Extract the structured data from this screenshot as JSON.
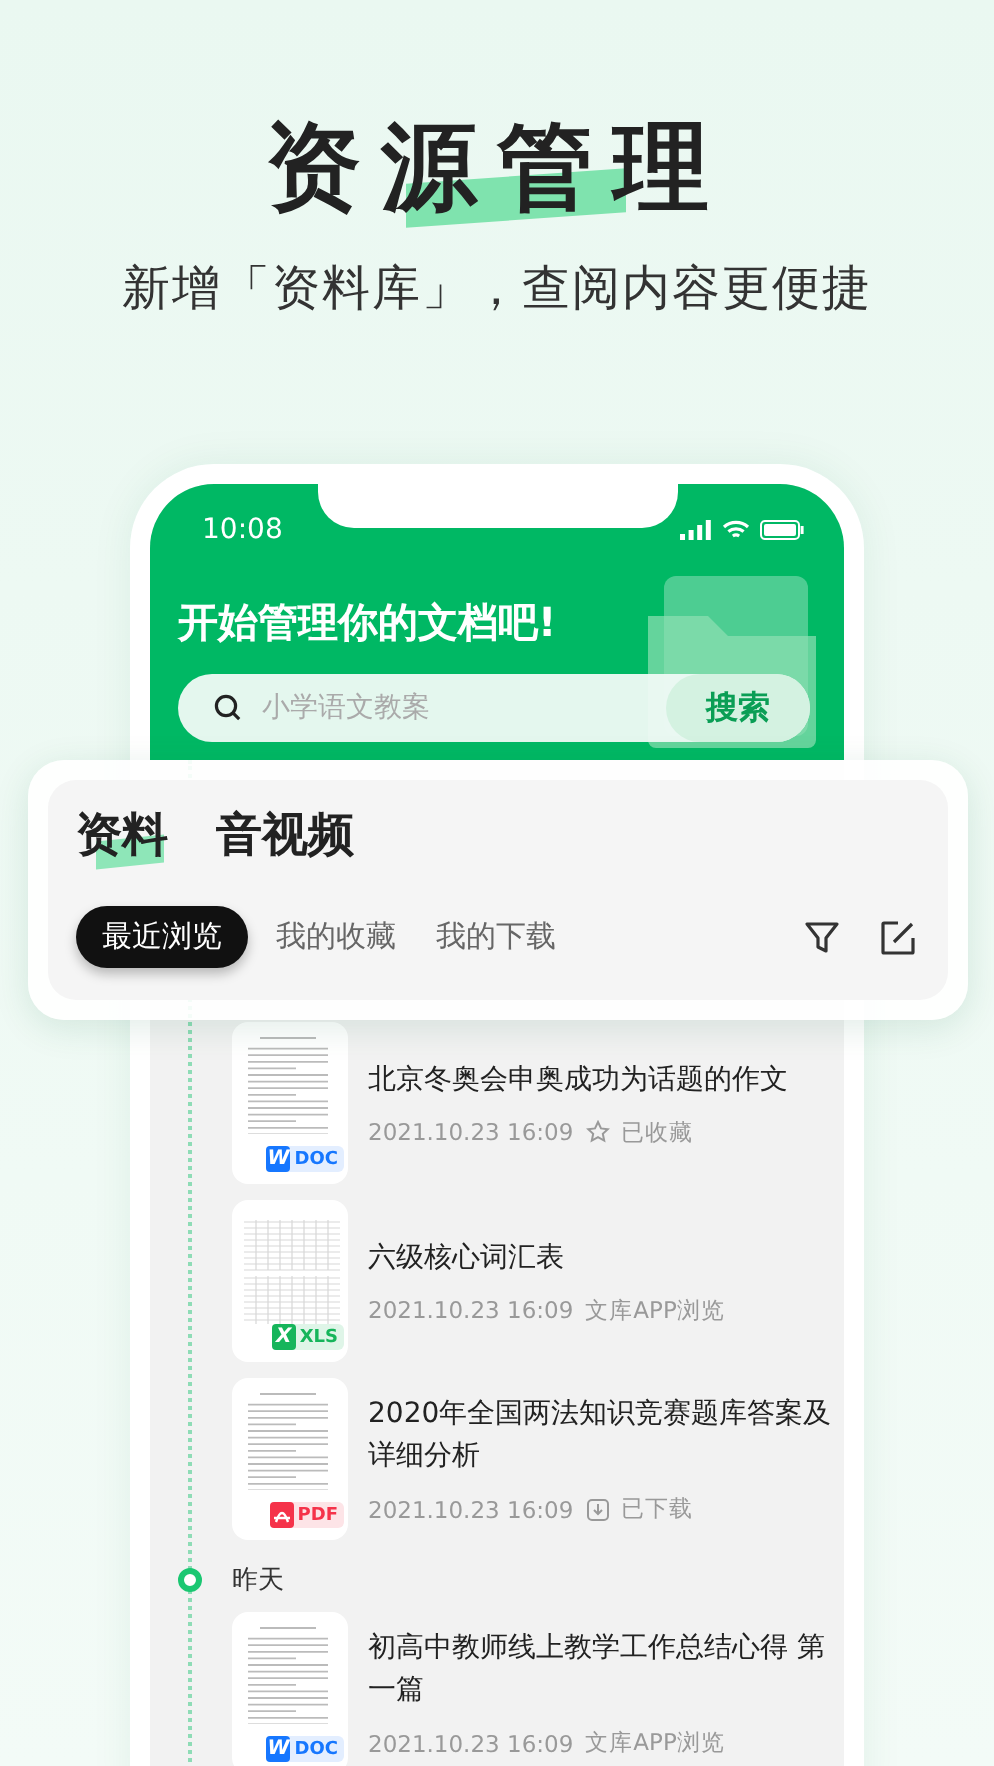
{
  "headline": {
    "title": "资源管理",
    "subtitle": "新增「资料库」，查阅内容更便捷"
  },
  "status_bar": {
    "time": "10:08"
  },
  "header": {
    "title": "开始管理你的文档吧!",
    "search": {
      "placeholder": "小学语文教案",
      "button": "搜索"
    }
  },
  "tabs": [
    {
      "label": "资料",
      "selected": true
    },
    {
      "label": "音视频",
      "selected": false
    }
  ],
  "filters": [
    {
      "label": "最近浏览",
      "selected": true
    },
    {
      "label": "我的收藏",
      "selected": false
    },
    {
      "label": "我的下载",
      "selected": false
    }
  ],
  "sections": [
    {
      "items": [
        {
          "title": "北京冬奥会申奥成功为话题的作文",
          "time": "2021.10.23 16:09",
          "status": {
            "kind": "starred",
            "label": "已收藏"
          },
          "badge": {
            "kind": "doc",
            "glyph": "W",
            "label": "DOC"
          }
        },
        {
          "title": "六级核心词汇表",
          "time": "2021.10.23 16:09",
          "status": {
            "kind": "viewed",
            "label": "文库APP浏览"
          },
          "badge": {
            "kind": "xls",
            "glyph": "X",
            "label": "XLS"
          }
        },
        {
          "title": "2020年全国两法知识竞赛题库答案及详细分析",
          "time": "2021.10.23 16:09",
          "status": {
            "kind": "downloaded",
            "label": "已下载"
          },
          "badge": {
            "kind": "pdf",
            "label": "PDF"
          }
        }
      ]
    },
    {
      "label": "昨天",
      "items": [
        {
          "title": "初高中教师线上教学工作总结心得 第一篇",
          "time": "2021.10.23 16:09",
          "status": {
            "kind": "viewed",
            "label": "文库APP浏览"
          },
          "badge": {
            "kind": "doc",
            "glyph": "W",
            "label": "DOC"
          }
        }
      ]
    }
  ]
}
